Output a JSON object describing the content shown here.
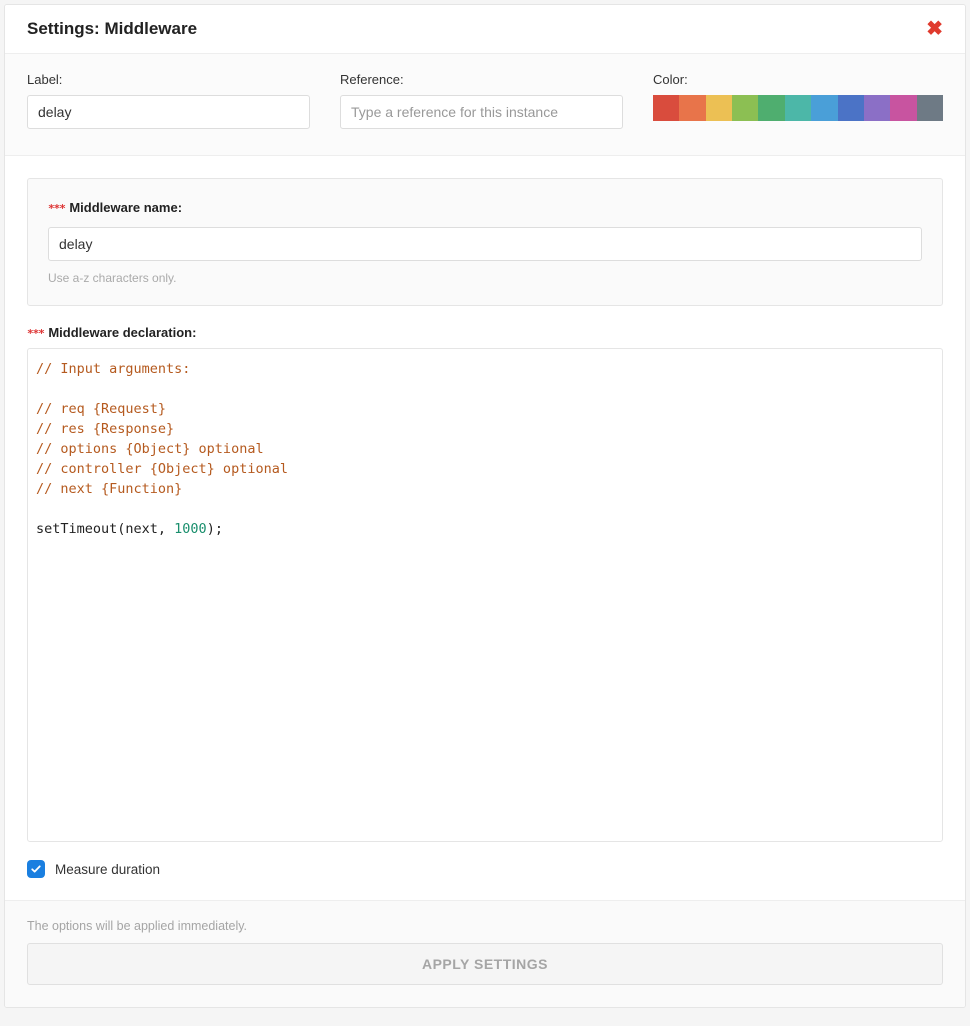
{
  "header": {
    "title": "Settings: Middleware"
  },
  "top": {
    "label_caption": "Label:",
    "label_value": "delay",
    "reference_caption": "Reference:",
    "reference_placeholder": "Type a reference for this instance",
    "color_caption": "Color:",
    "colors": [
      "#d94c3d",
      "#e8744a",
      "#ecc054",
      "#8cbf53",
      "#4fae6f",
      "#4cb7a8",
      "#4a9fd8",
      "#4b73c6",
      "#8b6fc6",
      "#c854a0",
      "#6e7a85"
    ]
  },
  "name": {
    "label": "Middleware name:",
    "value": "delay",
    "hint": "Use a-z characters only."
  },
  "decl": {
    "label": "Middleware declaration:",
    "code_lines": [
      {
        "t": "comment",
        "v": "// Input arguments:"
      },
      {
        "t": "blank",
        "v": ""
      },
      {
        "t": "comment",
        "v": "// req {Request}"
      },
      {
        "t": "comment",
        "v": "// res {Response}"
      },
      {
        "t": "comment",
        "v": "// options {Object} optional"
      },
      {
        "t": "comment",
        "v": "// controller {Object} optional"
      },
      {
        "t": "comment",
        "v": "// next {Function}"
      },
      {
        "t": "blank",
        "v": ""
      },
      {
        "t": "call",
        "pre": "setTimeout(next, ",
        "num": "1000",
        "post": ");"
      }
    ]
  },
  "measure": {
    "label": "Measure duration",
    "checked": true
  },
  "footer": {
    "note": "The options will be applied immediately.",
    "button": "APPLY SETTINGS"
  }
}
